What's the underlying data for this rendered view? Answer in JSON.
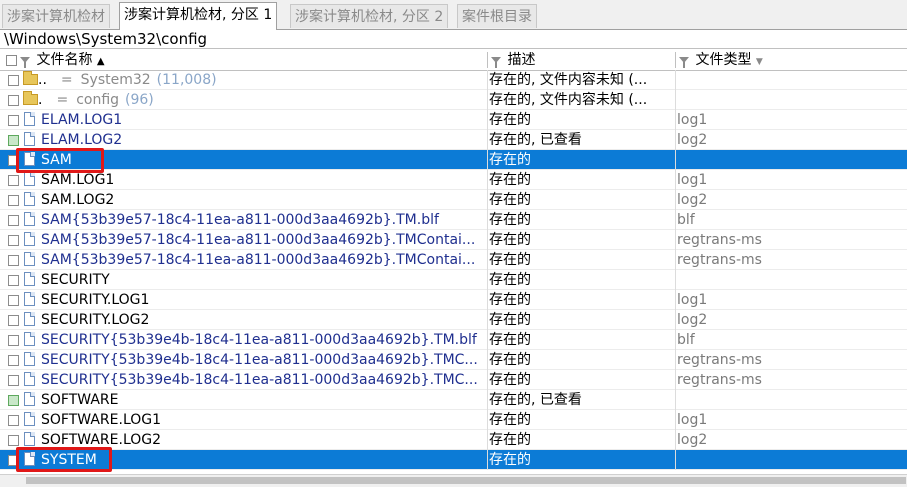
{
  "tabs": [
    {
      "label": "涉案计算机检材"
    },
    {
      "label": "涉案计算机检材, 分区 1"
    },
    {
      "label": "涉案计算机检材, 分区 2"
    },
    {
      "label": "案件根目录"
    }
  ],
  "path": "\\Windows\\System32\\config",
  "columns": {
    "name": "文件名称",
    "desc": "描述",
    "type": "文件类型"
  },
  "rows": [
    {
      "dots": "..",
      "eq": "=",
      "label": "System32",
      "count": "(11,008)",
      "desc": "存在的, 文件内容未知 (...",
      "type": ""
    },
    {
      "dots": ".",
      "eq": "=",
      "label": "config",
      "count": "(96)",
      "desc": "存在的, 文件内容未知 (...",
      "type": ""
    },
    {
      "name": "ELAM.LOG1",
      "desc": "存在的",
      "type": "log1"
    },
    {
      "name": "ELAM.LOG2",
      "desc": "存在的, 已查看",
      "type": "log2"
    },
    {
      "name": "SAM",
      "desc": "存在的",
      "type": ""
    },
    {
      "name": "SAM.LOG1",
      "desc": "存在的",
      "type": "log1"
    },
    {
      "name": "SAM.LOG2",
      "desc": "存在的",
      "type": "log2"
    },
    {
      "name": "SAM{53b39e57-18c4-11ea-a811-000d3aa4692b}.TM.blf",
      "desc": "存在的",
      "type": "blf"
    },
    {
      "name": "SAM{53b39e57-18c4-11ea-a811-000d3aa4692b}.TMContai...",
      "desc": "存在的",
      "type": "regtrans-ms"
    },
    {
      "name": "SAM{53b39e57-18c4-11ea-a811-000d3aa4692b}.TMContai...",
      "desc": "存在的",
      "type": "regtrans-ms"
    },
    {
      "name": "SECURITY",
      "desc": "存在的",
      "type": ""
    },
    {
      "name": "SECURITY.LOG1",
      "desc": "存在的",
      "type": "log1"
    },
    {
      "name": "SECURITY.LOG2",
      "desc": "存在的",
      "type": "log2"
    },
    {
      "name": "SECURITY{53b39e4b-18c4-11ea-a811-000d3aa4692b}.TM.blf",
      "desc": "存在的",
      "type": "blf"
    },
    {
      "name": "SECURITY{53b39e4b-18c4-11ea-a811-000d3aa4692b}.TMC...",
      "desc": "存在的",
      "type": "regtrans-ms"
    },
    {
      "name": "SECURITY{53b39e4b-18c4-11ea-a811-000d3aa4692b}.TMC...",
      "desc": "存在的",
      "type": "regtrans-ms"
    },
    {
      "name": "SOFTWARE",
      "desc": "存在的, 已查看",
      "type": ""
    },
    {
      "name": "SOFTWARE.LOG1",
      "desc": "存在的",
      "type": "log1"
    },
    {
      "name": "SOFTWARE.LOG2",
      "desc": "存在的",
      "type": "log2"
    },
    {
      "name": "SYSTEM",
      "desc": "存在的",
      "type": ""
    }
  ],
  "colors": {
    "selection": "#0c7bd6",
    "highlight_box": "#e01818",
    "link_blue": "#1f2f8f"
  }
}
